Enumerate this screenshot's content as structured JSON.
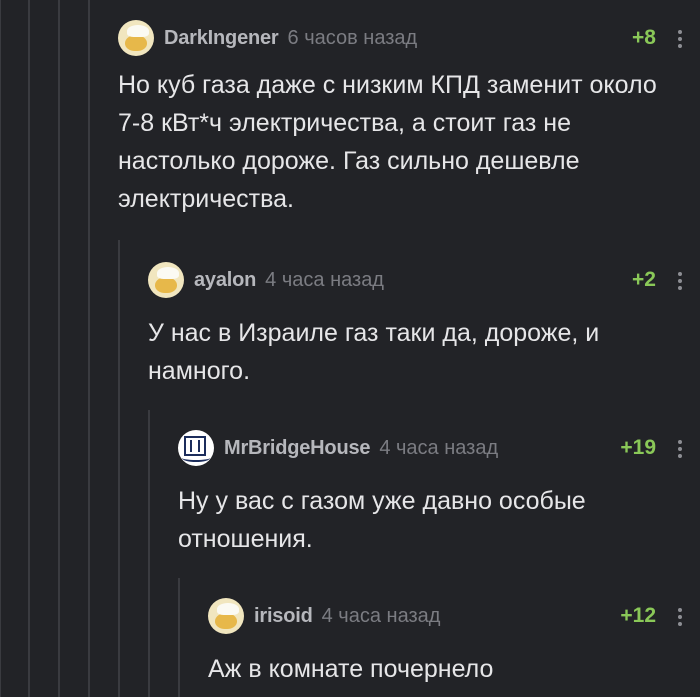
{
  "comments": [
    {
      "username": "DarkIngener",
      "time": "6 часов назад",
      "rating": "+8",
      "text": "Но куб газа даже с низким КПД заменит около 7-8 кВт*ч электричества, а стоит газ не настолько дороже. Газ сильно дешевле электричества.",
      "avatar_icon": "chef-hat-avatar-icon"
    },
    {
      "username": "ayalon",
      "time": "4 часа назад",
      "rating": "+2",
      "text": "У нас в Израиле газ таки да, дороже, и намного.",
      "avatar_icon": "chef-hat-avatar-icon"
    },
    {
      "username": "MrBridgeHouse",
      "time": "4 часа назад",
      "rating": "+19",
      "text": "Ну у вас с газом уже давно особые отношения.",
      "avatar_icon": "bridge-house-logo-icon"
    },
    {
      "username": "irisoid",
      "time": "4 часа назад",
      "rating": "+12",
      "text": "Аж в комнате почернело",
      "avatar_icon": "chef-hat-avatar-icon"
    }
  ],
  "colors": {
    "background": "#222327",
    "rating_positive": "#8ac858",
    "username": "#b6b7bc",
    "time": "#7b7c82",
    "text": "#e6e6e8",
    "thread_line": "#3a3b40"
  }
}
